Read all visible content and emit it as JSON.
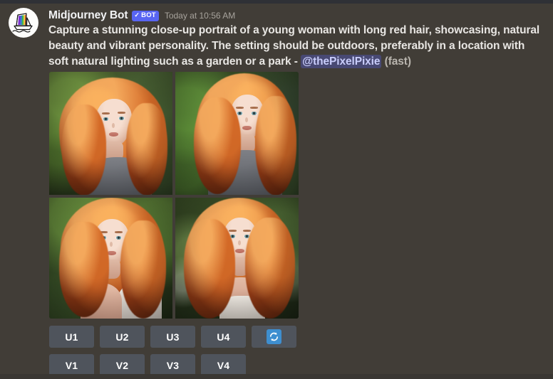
{
  "message": {
    "author": "Midjourney Bot",
    "bot_badge": {
      "check": "✓",
      "label": "BOT"
    },
    "timestamp": "Today at 10:56 AM",
    "prompt_text": "Capture a stunning close-up portrait of a young woman with long red hair, showcasing, natural beauty and vibrant personality. The setting should be outdoors, preferably in a location with soft natural lighting such as a garden or a park - ",
    "mention": "@thePixelPixie",
    "speed_note": "(fast)",
    "avatar_icon": "midjourney-sailboat-icon"
  },
  "attachment": {
    "name": "midjourney-2x2-image-grid",
    "quadrants": [
      {
        "position": "top-left",
        "alt": "Portrait of young woman with long red hair, gray tank top, green foliage background"
      },
      {
        "position": "top-right",
        "alt": "Portrait of young woman with long red hair, gray t-shirt, leafy green background"
      },
      {
        "position": "bottom-left",
        "alt": "Portrait of young woman with wavy red hair, light strap top, blurred garden background"
      },
      {
        "position": "bottom-right",
        "alt": "Portrait of young woman with voluminous red hair, white dress, bokeh flower background"
      }
    ]
  },
  "actions": {
    "upscale_row": [
      "U1",
      "U2",
      "U3",
      "U4"
    ],
    "variation_row": [
      "V1",
      "V2",
      "V3",
      "V4"
    ],
    "reroll": {
      "icon": "reroll-arrows-icon",
      "label": "🔄"
    }
  },
  "colors": {
    "message_background": "#413d37",
    "page_background": "#2b2d31",
    "button_background": "#4f545c",
    "bot_badge": "#5865f2",
    "mention_text": "#c9cdfb",
    "reroll_emoji": "#3e8fd0",
    "text_primary": "#e8e6e3",
    "text_muted": "#a7a39c"
  }
}
